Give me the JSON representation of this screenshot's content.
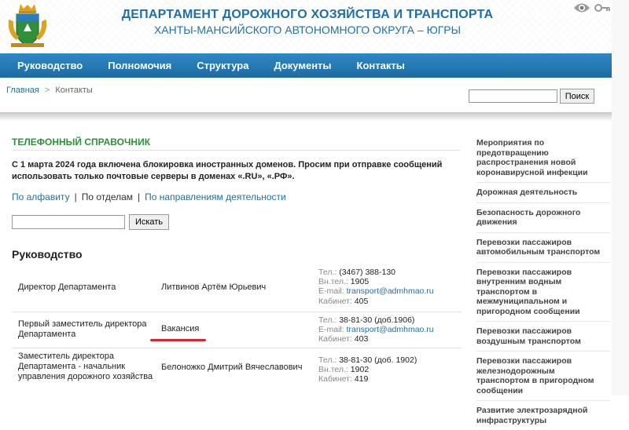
{
  "header": {
    "title_line1": "ДЕПАРТАМЕНТ ДОРОЖНОГО ХОЗЯЙСТВА И ТРАНСПОРТА",
    "title_line2": "ХАНТЫ-МАНСИЙСКОГО АВТОНОМНОГО ОКРУГА – ЮГРЫ",
    "logo_icon": "coat-of-arms-icon",
    "accessibility_icon": "eye-icon",
    "login_icon": "key-icon"
  },
  "nav": {
    "items": [
      {
        "label": "Руководство"
      },
      {
        "label": "Полномочия"
      },
      {
        "label": "Структура"
      },
      {
        "label": "Документы"
      },
      {
        "label": "Контакты"
      }
    ]
  },
  "breadcrumb": {
    "home": "Главная",
    "separator": ">",
    "current": "Контакты"
  },
  "top_search": {
    "value": "",
    "button": "Поиск"
  },
  "main": {
    "section_title": "ТЕЛЕФОННЫЙ СПРАВОЧНИК",
    "notice": "С 1 марта 2024 года включена блокировка иностранных доменов. Просим при отправке сообщений использовать только почтовые серверы в доменах «.RU», «.РФ».",
    "tabs": {
      "alphabet": "По алфавиту",
      "separator": "|",
      "departments": "По отделам",
      "directions": "По направлениям деятельности"
    },
    "search": {
      "value": "",
      "button": "Искать"
    },
    "group_title": "Руководство",
    "rows": [
      {
        "position": "Директор Департамента",
        "name": "Литвинов Артём Юрьевич",
        "phone_label": "Тел.:",
        "phone": "(3467) 388-130",
        "ext_label": "Вн.тел.:",
        "ext": "1905",
        "email_label": "E-mail:",
        "email": "transport@admhmao.ru",
        "cabinet_label": "Кабинет:",
        "cabinet": "405"
      },
      {
        "position": "Первый заместитель директора Департамента",
        "name": "Вакансия",
        "phone_label": "Тел.:",
        "phone": "38-81-30 (доб.1906)",
        "email_label": "E-mail:",
        "email": "transport@admhmao.ru",
        "cabinet_label": "Кабинет:",
        "cabinet": "403"
      },
      {
        "position": "Заместитель директора Департамента - начальник управления дорожного хозяйства",
        "name": "Белоножко Дмитрий Вячеславович",
        "phone_label": "Тел.:",
        "phone": "38-81-30 (доб. 1902)",
        "ext_label": "Вн.тел.:",
        "ext": "1902",
        "cabinet_label": "Кабинет:",
        "cabinet": "419"
      }
    ]
  },
  "sidebar": {
    "links": [
      "Мероприятия по предотвращению распространения новой коронавирусной инфекции",
      "Дорожная деятельность",
      "Безопасность дорожного движения",
      "Перевозки пассажиров автомобильным транспортом",
      "Перевозки пассажиров внутренним водным транспортом в межмуниципальном и пригородном сообщении",
      "Перевозки пассажиров воздушным транспортом",
      "Перевозки пассажиров железнодорожным транспортом в пригородном сообщении",
      "Развитие электрозарядной инфраструктуры"
    ]
  },
  "colors": {
    "brand_blue": "#1f6fa6",
    "nav_blue": "#2a7fbb",
    "section_green": "#2f8f3a",
    "highlight_red": "#e0232a"
  }
}
